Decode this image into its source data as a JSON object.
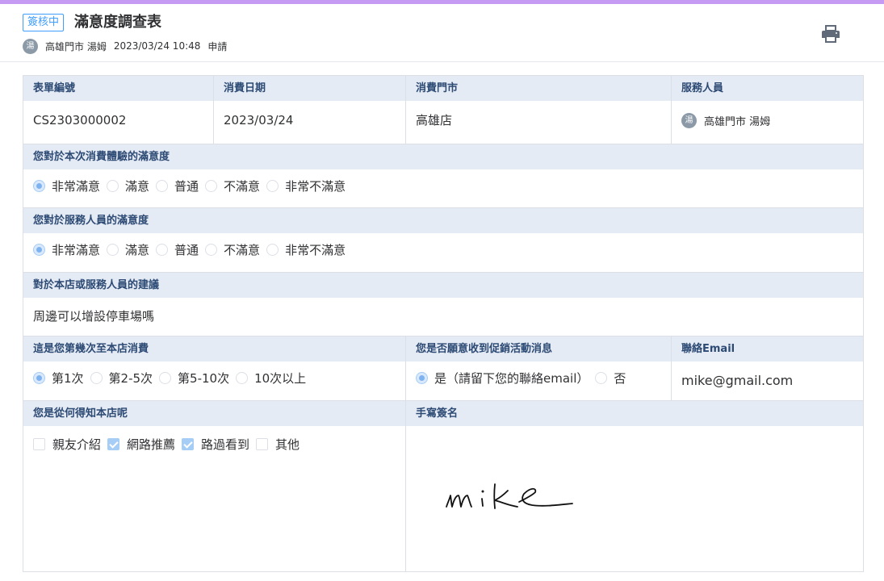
{
  "header": {
    "status_badge": "簽核中",
    "title": "滿意度調查表",
    "avatar_text": "湯",
    "applicant": "高雄門市 湯姆",
    "datetime": "2023/03/24 10:48",
    "action": "申請"
  },
  "fields": {
    "form_no": {
      "label": "表單編號",
      "value": "CS2303000002"
    },
    "date": {
      "label": "消費日期",
      "value": "2023/03/24"
    },
    "store": {
      "label": "消費門市",
      "value": "高雄店"
    },
    "staff": {
      "label": "服務人員",
      "avatar_text": "湯",
      "value": "高雄門市 湯姆"
    },
    "experience": {
      "label": "您對於本次消費體驗的滿意度",
      "options": [
        "非常滿意",
        "滿意",
        "普通",
        "不滿意",
        "非常不滿意"
      ],
      "selected": "非常滿意"
    },
    "staff_satisfaction": {
      "label": "您對於服務人員的滿意度",
      "options": [
        "非常滿意",
        "滿意",
        "普通",
        "不滿意",
        "非常不滿意"
      ],
      "selected": "非常滿意"
    },
    "suggestion": {
      "label": "對於本店或服務人員的建議",
      "value": "周邊可以增設停車場嗎"
    },
    "visit_count": {
      "label": "這是您第幾次至本店消費",
      "options": [
        "第1次",
        "第2-5次",
        "第5-10次",
        "10次以上"
      ],
      "selected": "第1次"
    },
    "promo": {
      "label": "您是否願意收到促銷活動消息",
      "options": [
        "是（請留下您的聯絡email）",
        "否"
      ],
      "selected": "是（請留下您的聯絡email）"
    },
    "email": {
      "label": "聯絡Email",
      "value": "mike@gmail.com"
    },
    "source": {
      "label": "您是從何得知本店呢",
      "options": [
        "親友介紹",
        "網路推薦",
        "路過看到",
        "其他"
      ],
      "checked": [
        "網路推薦",
        "路過看到"
      ]
    },
    "signature": {
      "label": "手寫簽名",
      "handwriting": "mike"
    }
  },
  "icons": {
    "print": "printer-icon"
  },
  "colors": {
    "accent": "#409eff",
    "label_bg": "#e5ebf4",
    "label_text": "#2c4a74",
    "top_bar": "#c59af2"
  }
}
